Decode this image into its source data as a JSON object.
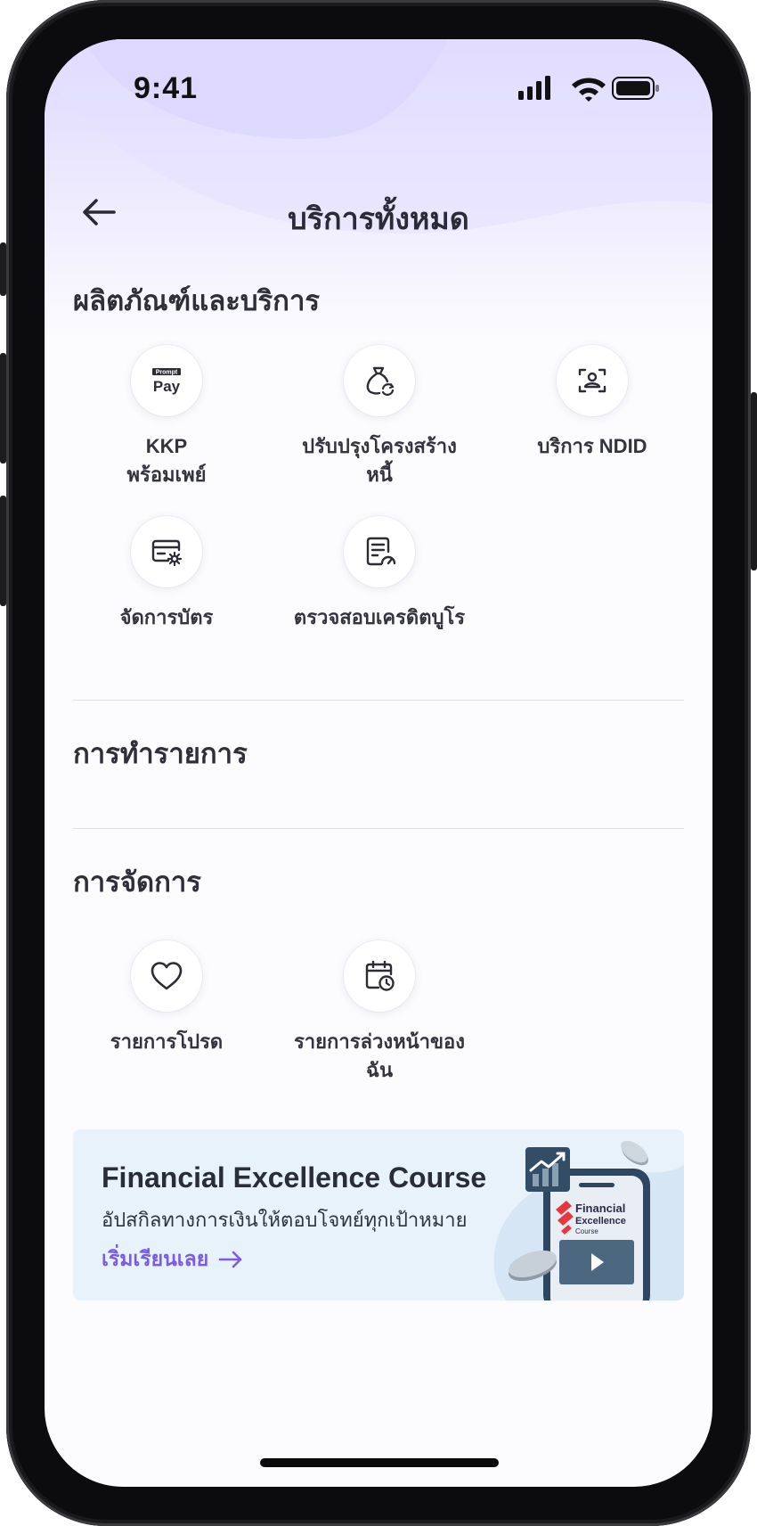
{
  "status_bar": {
    "time": "9:41"
  },
  "nav": {
    "title": "บริการทั้งหมด"
  },
  "sections": {
    "products": {
      "title": "ผลิตภัณฑ์และบริการ",
      "items": [
        {
          "label": "KKP\nพร้อมเพย์",
          "icon": "promptpay-icon"
        },
        {
          "label": "ปรับปรุงโครงสร้าง\nหนี้",
          "icon": "money-bag-refresh-icon"
        },
        {
          "label": "บริการ NDID",
          "icon": "id-scan-icon"
        },
        {
          "label": "จัดการบัตร",
          "icon": "card-settings-icon"
        },
        {
          "label": "ตรวจสอบเครดิตบูโร",
          "icon": "document-check-icon"
        }
      ]
    },
    "transactions": {
      "title": "การทำรายการ"
    },
    "management": {
      "title": "การจัดการ",
      "items": [
        {
          "label": "รายการโปรด",
          "icon": "heart-icon"
        },
        {
          "label": "รายการล่วงหน้าของ\nฉัน",
          "icon": "calendar-clock-icon"
        }
      ]
    }
  },
  "banner": {
    "title": "Financial Excellence Course",
    "subtitle": "อัปสกิลทางการเงินให้ตอบโจทย์ทุกเป้าหมาย",
    "cta": "เริ่มเรียนเลย",
    "art_text": {
      "line1": "Financial",
      "line2": "Excellence",
      "line3": "Course"
    }
  },
  "promptpay_mark": {
    "top": "Prompt",
    "bottom": "Pay"
  },
  "colors": {
    "accent": "#7b5ce6",
    "header_tint": "#dcd6ff",
    "banner_bg": "#e7f2fb"
  }
}
